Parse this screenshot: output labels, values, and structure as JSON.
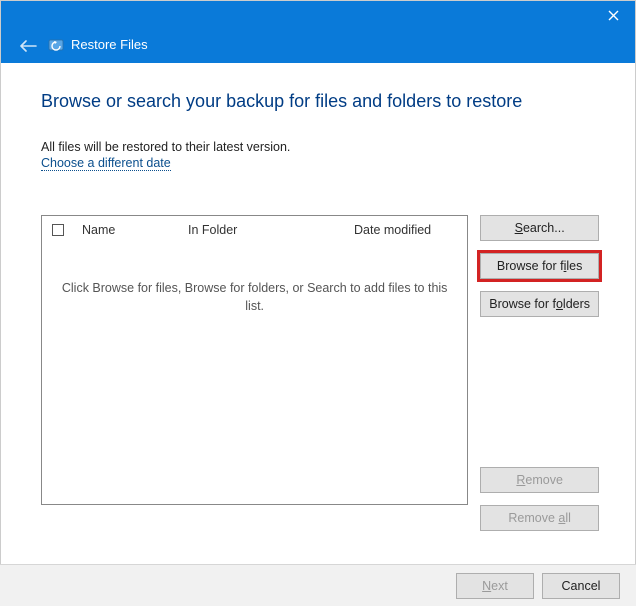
{
  "window": {
    "title": "Restore Files"
  },
  "heading": "Browse or search your backup for files and folders to restore",
  "info": "All files will be restored to their latest version.",
  "link": "Choose a different date",
  "table": {
    "col_name": "Name",
    "col_folder": "In Folder",
    "col_date": "Date modified",
    "empty_msg": "Click Browse for files, Browse for folders, or Search to add files to this list."
  },
  "buttons": {
    "search": "Search...",
    "browse_files": "Browse for files",
    "browse_folders": "Browse for folders",
    "remove": "Remove",
    "remove_all": "Remove all",
    "next": "Next",
    "cancel": "Cancel"
  }
}
